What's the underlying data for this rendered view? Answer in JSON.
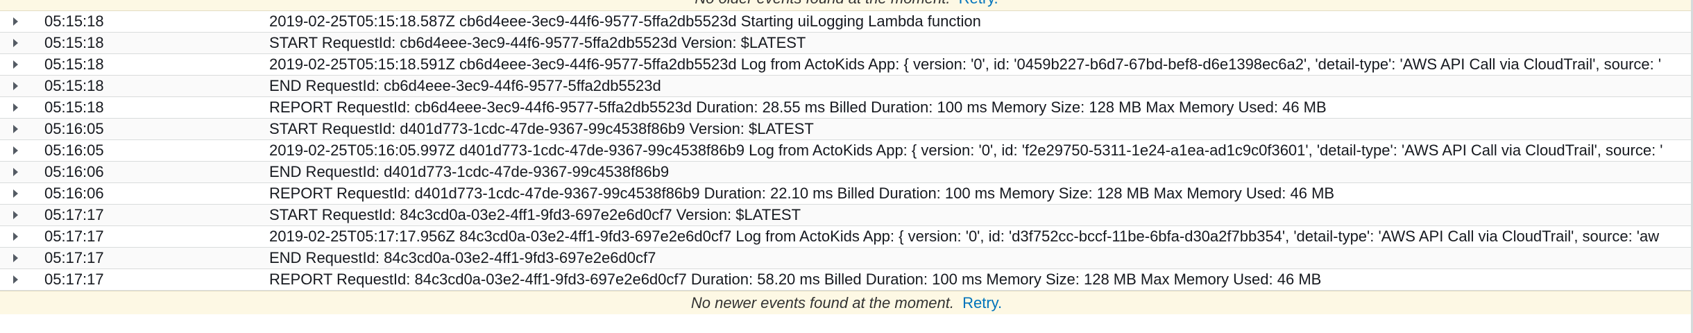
{
  "banners": {
    "top_message": "No older events found at the moment.",
    "bottom_message": "No newer events found at the moment.",
    "retry_label": "Retry."
  },
  "log_rows": [
    {
      "time": "05:15:18",
      "message": "2019-02-25T05:15:18.587Z cb6d4eee-3ec9-44f6-9577-5ffa2db5523d Starting uiLogging Lambda function"
    },
    {
      "time": "05:15:18",
      "message": "START RequestId: cb6d4eee-3ec9-44f6-9577-5ffa2db5523d Version: $LATEST"
    },
    {
      "time": "05:15:18",
      "message": "2019-02-25T05:15:18.591Z cb6d4eee-3ec9-44f6-9577-5ffa2db5523d Log from ActoKids App: { version: '0', id: '0459b227-b6d7-67bd-bef8-d6e1398ec6a2', 'detail-type': 'AWS API Call via CloudTrail', source: '"
    },
    {
      "time": "05:15:18",
      "message": "END RequestId: cb6d4eee-3ec9-44f6-9577-5ffa2db5523d"
    },
    {
      "time": "05:15:18",
      "message": "REPORT RequestId: cb6d4eee-3ec9-44f6-9577-5ffa2db5523d Duration: 28.55 ms Billed Duration: 100 ms Memory Size: 128 MB Max Memory Used: 46 MB"
    },
    {
      "time": "05:16:05",
      "message": "START RequestId: d401d773-1cdc-47de-9367-99c4538f86b9 Version: $LATEST"
    },
    {
      "time": "05:16:05",
      "message": "2019-02-25T05:16:05.997Z d401d773-1cdc-47de-9367-99c4538f86b9 Log from ActoKids App: { version: '0', id: 'f2e29750-5311-1e24-a1ea-ad1c9c0f3601', 'detail-type': 'AWS API Call via CloudTrail', source: '"
    },
    {
      "time": "05:16:06",
      "message": "END RequestId: d401d773-1cdc-47de-9367-99c4538f86b9"
    },
    {
      "time": "05:16:06",
      "message": "REPORT RequestId: d401d773-1cdc-47de-9367-99c4538f86b9 Duration: 22.10 ms Billed Duration: 100 ms Memory Size: 128 MB Max Memory Used: 46 MB"
    },
    {
      "time": "05:17:17",
      "message": "START RequestId: 84c3cd0a-03e2-4ff1-9fd3-697e2e6d0cf7 Version: $LATEST"
    },
    {
      "time": "05:17:17",
      "message": "2019-02-25T05:17:17.956Z 84c3cd0a-03e2-4ff1-9fd3-697e2e6d0cf7 Log from ActoKids App: { version: '0', id: 'd3f752cc-bccf-11be-6bfa-d30a2f7bb354', 'detail-type': 'AWS API Call via CloudTrail', source: 'aw"
    },
    {
      "time": "05:17:17",
      "message": "END RequestId: 84c3cd0a-03e2-4ff1-9fd3-697e2e6d0cf7"
    },
    {
      "time": "05:17:17",
      "message": "REPORT RequestId: 84c3cd0a-03e2-4ff1-9fd3-697e2e6d0cf7 Duration: 58.20 ms Billed Duration: 100 ms Memory Size: 128 MB Max Memory Used: 46 MB"
    }
  ],
  "icons": {
    "row_expand": "caret-right-icon"
  },
  "colors": {
    "banner_bg": "#fdf8e4",
    "link": "#0073bb",
    "row_border": "#d9dcdc"
  }
}
